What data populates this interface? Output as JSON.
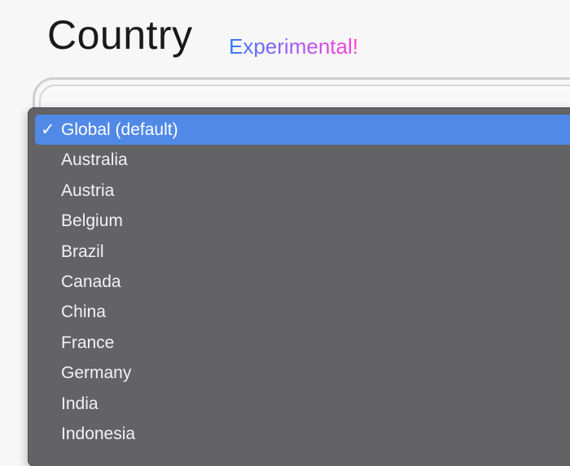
{
  "header": {
    "title": "Country",
    "badge": "Experimental!"
  },
  "colors": {
    "menu_bg": "#636265",
    "highlight": "#5189e7",
    "badge_gradient": [
      "#2f7cf6",
      "#a45cf5",
      "#ff3fd8"
    ]
  },
  "country_select": {
    "selected": "Global (default)",
    "check_icon": "✓",
    "options": [
      {
        "label": "Global (default)",
        "selected": true
      },
      {
        "label": "Australia"
      },
      {
        "label": "Austria"
      },
      {
        "label": "Belgium"
      },
      {
        "label": "Brazil"
      },
      {
        "label": "Canada"
      },
      {
        "label": "China"
      },
      {
        "label": "France"
      },
      {
        "label": "Germany"
      },
      {
        "label": "India"
      },
      {
        "label": "Indonesia"
      }
    ]
  }
}
